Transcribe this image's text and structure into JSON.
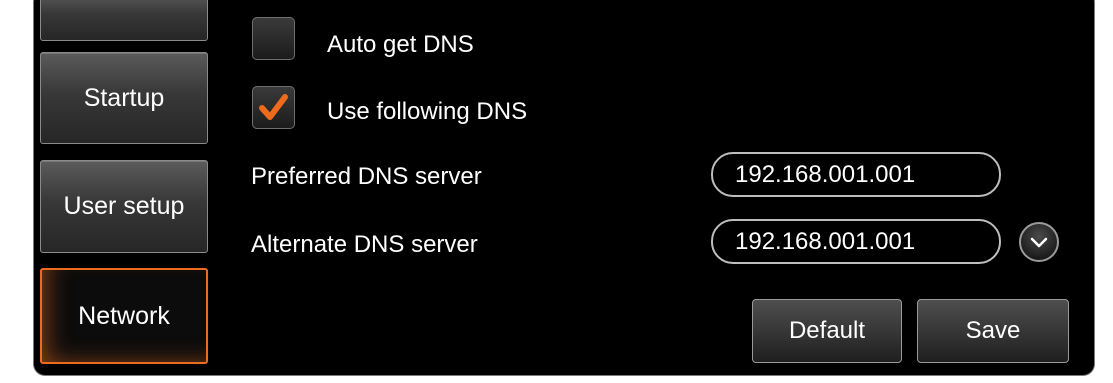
{
  "sidebar": {
    "items": [
      {
        "label": ""
      },
      {
        "label": "Startup"
      },
      {
        "label": "User setup"
      },
      {
        "label": "Network"
      }
    ],
    "active_index": 3
  },
  "dns": {
    "auto_label": "Auto get DNS",
    "auto_checked": false,
    "use_following_label": "Use following DNS",
    "use_following_checked": true,
    "preferred_label": "Preferred DNS server",
    "preferred_value": "192.168.001.001",
    "alternate_label": "Alternate DNS server",
    "alternate_value": "192.168.001.001"
  },
  "actions": {
    "default_label": "Default",
    "save_label": "Save"
  },
  "colors": {
    "accent": "#ec6b1c",
    "background": "#000000",
    "text": "#ffffff"
  },
  "icons": {
    "check": "check-icon",
    "dropdown": "chevron-down-icon"
  }
}
